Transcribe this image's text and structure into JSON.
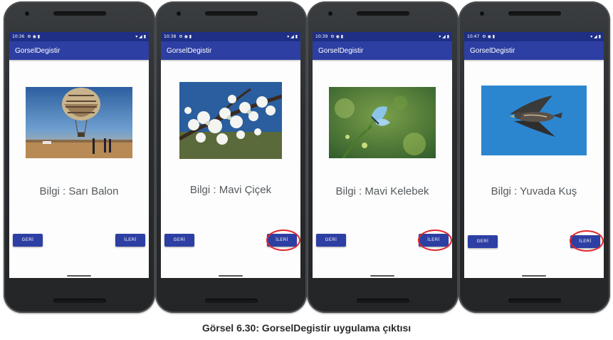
{
  "caption": "Görsel 6.30: GorselDegistir uygulama çıktısı",
  "phones": [
    {
      "status_time": "10:36",
      "app_title": "GorselDegistir",
      "image_name": "hot-air-balloon-photo",
      "info_text": "Bilgi : Sarı Balon",
      "back_label": "GERİ",
      "next_label": "İLERİ",
      "next_circled": false
    },
    {
      "status_time": "10:38",
      "app_title": "GorselDegistir",
      "image_name": "blossom-branch-photo",
      "info_text": "Bilgi : Mavi Çiçek",
      "back_label": "GERİ",
      "next_label": "İLERİ",
      "next_circled": true
    },
    {
      "status_time": "10:39",
      "app_title": "GorselDegistir",
      "image_name": "blue-butterfly-photo",
      "info_text": "Bilgi : Mavi Kelebek",
      "back_label": "GERİ",
      "next_label": "İLERİ",
      "next_circled": true
    },
    {
      "status_time": "10:47",
      "app_title": "GorselDegistir",
      "image_name": "falcon-photo",
      "info_text": "Bilgi : Yuvada Kuş",
      "back_label": "GERİ",
      "next_label": "İLERİ",
      "next_circled": true
    }
  ],
  "colors": {
    "appbar": "#2d3fa3",
    "statusbar": "#1f2f86",
    "button": "#2d3fa3",
    "circle_highlight": "#e0262b"
  }
}
